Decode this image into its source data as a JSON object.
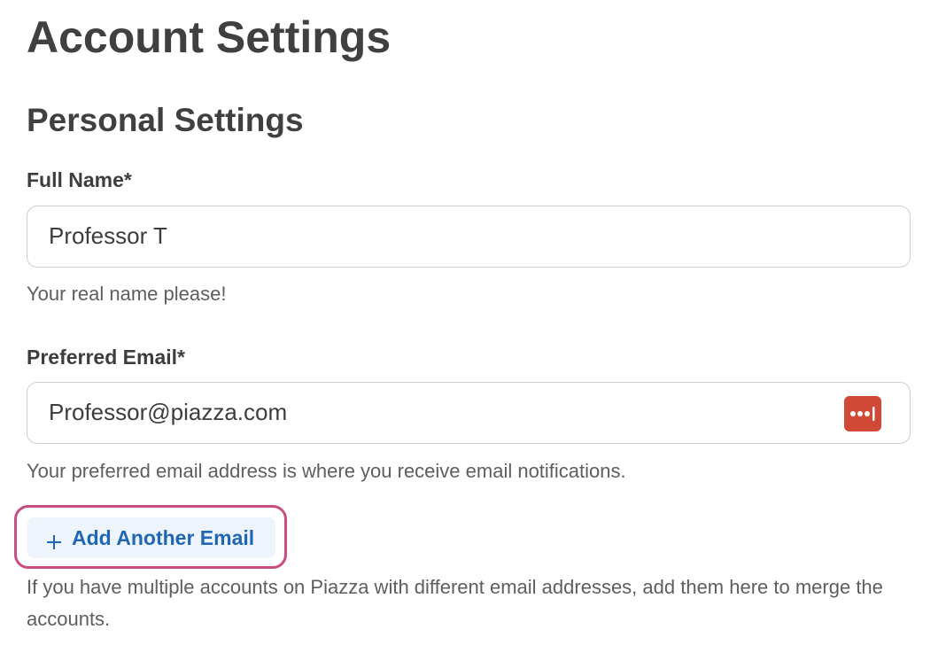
{
  "page": {
    "title": "Account Settings"
  },
  "personal": {
    "section_title": "Personal Settings",
    "full_name": {
      "label": "Full Name*",
      "value": "Professor T",
      "help": "Your real name please!"
    },
    "preferred_email": {
      "label": "Preferred Email*",
      "value": "Professor@piazza.com",
      "help": "Your preferred email address is where you receive email notifications.",
      "icon": "password-manager-icon"
    },
    "add_email": {
      "label": "Add Another Email",
      "icon": "plus-icon",
      "help": "If you have multiple accounts on Piazza with different email addresses, add them here to merge the accounts."
    }
  },
  "colors": {
    "heading": "#404040",
    "link_blue": "#1f67b5",
    "highlight_border": "#c84d80",
    "password_manager_red": "#d14836"
  }
}
